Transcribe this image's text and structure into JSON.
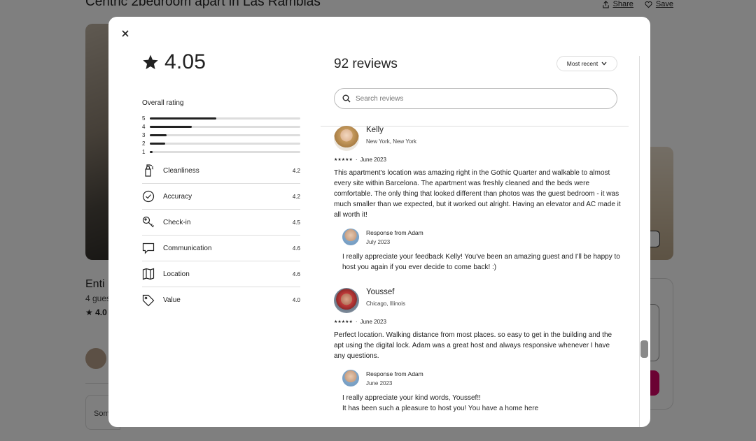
{
  "listing": {
    "title": "Centric 2bedroom apart in Las Ramblas",
    "share_label": "Share",
    "save_label": "Save",
    "entire_label": "Enti",
    "guests_label": "4 gues",
    "rating_short": "4.0",
    "some_label": "Som"
  },
  "modal": {
    "overall_rating": "4.05",
    "overall_label": "Overall rating",
    "distribution": [
      {
        "star": "5",
        "fraction": 0.44
      },
      {
        "star": "4",
        "fraction": 0.28
      },
      {
        "star": "3",
        "fraction": 0.11
      },
      {
        "star": "2",
        "fraction": 0.1
      },
      {
        "star": "1",
        "fraction": 0.02
      }
    ],
    "categories": [
      {
        "name": "Cleanliness",
        "value": "4.2",
        "icon": "spray-bottle-icon"
      },
      {
        "name": "Accuracy",
        "value": "4.2",
        "icon": "check-circle-icon"
      },
      {
        "name": "Check-in",
        "value": "4.5",
        "icon": "key-icon"
      },
      {
        "name": "Communication",
        "value": "4.6",
        "icon": "chat-bubble-icon"
      },
      {
        "name": "Location",
        "value": "4.6",
        "icon": "map-icon"
      },
      {
        "name": "Value",
        "value": "4.0",
        "icon": "tag-icon"
      }
    ],
    "reviews_count": "92 reviews",
    "sort_label": "Most recent",
    "search_placeholder": "Search reviews",
    "reviews": [
      {
        "name": "Kelly",
        "location": "New York, New York",
        "stars": "★★★★★",
        "date": "June 2023",
        "text": "This apartment's location was amazing right in the Gothic Quarter and walkable to almost every site within Barcelona. The apartment was freshly cleaned and the beds were comfortable. The only thing that looked different than photos was the guest bedroom - it was much smaller than we expected, but it worked out alright. Having an elevator and AC made it all worth it!",
        "response_title": "Response from Adam",
        "response_date": "July 2023",
        "response_text": "I really appreciate your feedback Kelly! You've been an amazing guest and I'll be happy to host you again if you ever decide to come back! :)"
      },
      {
        "name": "Youssef",
        "location": "Chicago, Illinois",
        "stars": "★★★★★",
        "date": "June 2023",
        "text": "Perfect location. Walking distance from most places. so easy to get in the building and the apt using the digital lock. Adam was a great host and always responsive whenever I have any questions.",
        "response_title": "Response from Adam",
        "response_date": "June 2023",
        "response_text": "I really appreciate your kind words, Youssef!!\nIt has been such a pleasure to host you! You have a home here"
      }
    ]
  },
  "colors": {
    "accent": "#222222",
    "brand": "#d70466",
    "overlay": "#000000"
  }
}
